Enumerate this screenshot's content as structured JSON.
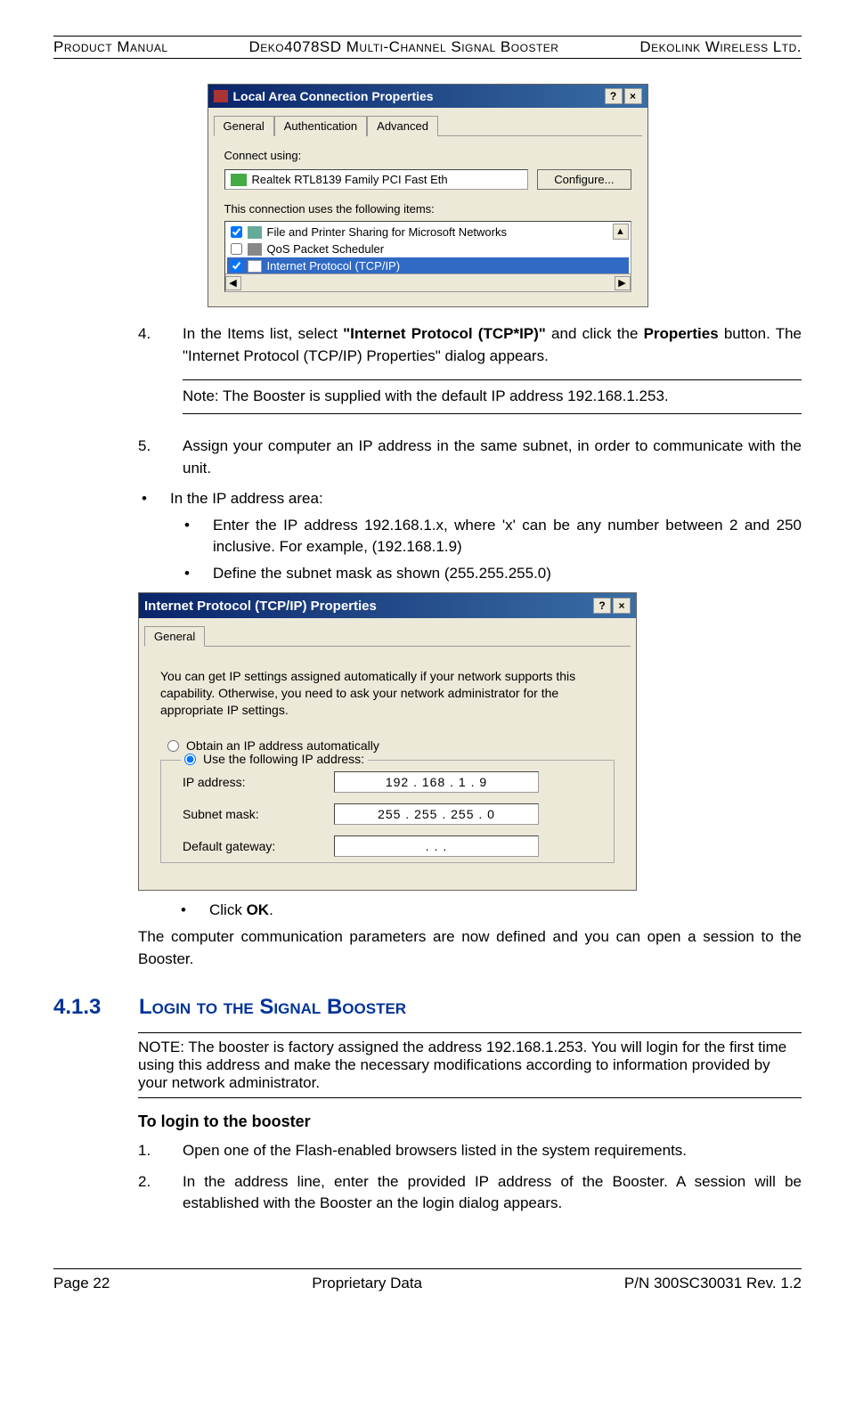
{
  "header": {
    "left": "Product Manual",
    "center": "Deko4078SD Multi-Channel Signal Booster",
    "right": "Dekolink Wireless Ltd."
  },
  "dialog1": {
    "title": "Local Area Connection Properties",
    "help": "?",
    "close": "×",
    "tabs": [
      "General",
      "Authentication",
      "Advanced"
    ],
    "connect_label": "Connect using:",
    "adapter": "Realtek RTL8139 Family PCI Fast Eth",
    "configure_btn": "Configure...",
    "items_label": "This connection uses the following items:",
    "item1": "File and Printer Sharing for Microsoft Networks",
    "item2": "QoS Packet Scheduler",
    "item3": "Internet Protocol (TCP/IP)",
    "scroll_up": "▲",
    "hs_left": "◀",
    "hs_right": "▶"
  },
  "step4": {
    "num": "4.",
    "pre": "In the Items list, select ",
    "bold1": "\"Internet Protocol (TCP*IP)\"",
    "mid": " and click the ",
    "bold2": "Properties",
    "post": " button. The \"Internet Protocol (TCP/IP) Properties\" dialog appears."
  },
  "note1": "Note:  The Booster is supplied with the default IP address 192.168.1.253.",
  "step5": {
    "num": "5.",
    "text": "Assign your computer an IP address in the same subnet, in order to communicate with the unit."
  },
  "bullet1": "In the IP address area:",
  "sub1": "Enter the IP address 192.168.1.x, where 'x' can be any number between 2 and 250 inclusive. For example,  (192.168.1.9)",
  "sub2": "Define the subnet mask as shown (255.255.255.0)",
  "dialog2": {
    "title": "Internet Protocol (TCP/IP) Properties",
    "help": "?",
    "close": "×",
    "tab": "General",
    "desc": "You can get IP settings assigned automatically if your network supports this capability. Otherwise, you need to ask your network administrator for the appropriate IP settings.",
    "radio1": "Obtain an IP address automatically",
    "radio2": "Use the following IP address:",
    "ip_label": "IP address:",
    "ip_value": "192 . 168 .   1   .     9",
    "mask_label": "Subnet mask:",
    "mask_value": "255 . 255 . 255 .   0",
    "gw_label": "Default gateway:",
    "gw_value": ".           .           ."
  },
  "sub3_pre": "Click ",
  "sub3_bold": "OK",
  "sub3_post": ".",
  "para_after": "The computer communication parameters are now defined and you can open a session to the Booster.",
  "section": {
    "num": "4.1.3",
    "title": "Login to the Signal Booster"
  },
  "note2": "NOTE: The booster is factory assigned the address 192.168.1.253. You will login for the first time using this address and make the necessary modifications according to information provided by your network administrator.",
  "subhead": "To login to the booster",
  "login1": {
    "num": "1.",
    "text": "Open one of the Flash-enabled browsers listed in the system requirements."
  },
  "login2": {
    "num": "2.",
    "text": "In the address line, enter the provided IP address of the Booster. A session will be established with the Booster an the login dialog appears."
  },
  "footer": {
    "left": "Page 22",
    "center": "Proprietary Data",
    "right": "P/N 300SC30031 Rev. 1.2"
  }
}
